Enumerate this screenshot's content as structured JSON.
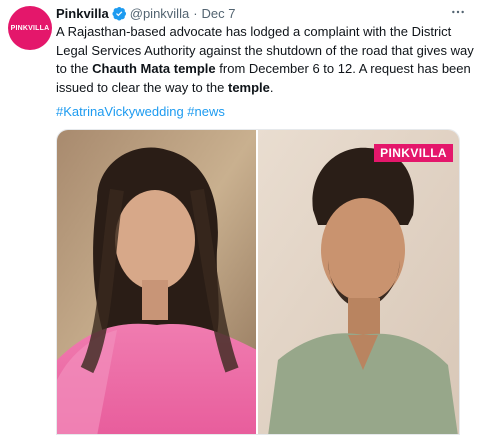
{
  "tweet": {
    "avatar_text": "PINKVILLA",
    "author_name": "Pinkvilla",
    "handle": "@pinkvilla",
    "separator": "·",
    "date": "Dec 7",
    "more_icon": "more-horizontal-icon",
    "verified_icon": "verified-badge-icon",
    "text": {
      "part1": "A Rajasthan-based advocate has lodged a complaint with the District Legal Services Authority against the shutdown of the road that gives way to the ",
      "bold1": "Chauth Mata temple",
      "part2": " from December 6 to 12. A request has been issued to clear the way to the ",
      "bold2": "temple",
      "part3": "."
    },
    "hashtags": [
      "#KatrinaVickywedding",
      "#news"
    ]
  },
  "media": {
    "watermark": "PINKVILLA",
    "accent_color": "#e4176b",
    "link_color": "#1d9bf0"
  }
}
